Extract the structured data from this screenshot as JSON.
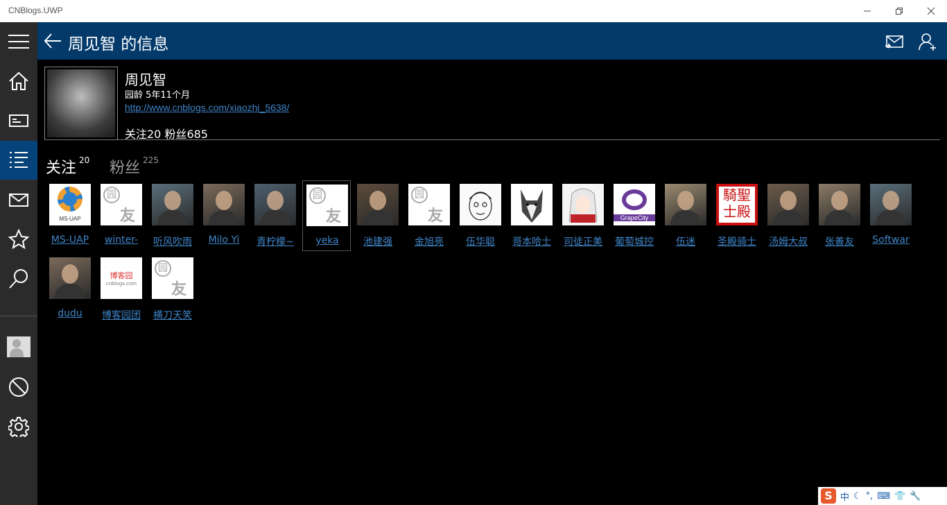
{
  "window": {
    "title": "CNBlogs.UWP"
  },
  "header": {
    "title": "周见智 的信息"
  },
  "profile": {
    "name": "周见智",
    "age": "园龄 5年11个月",
    "url": "http://www.cnblogs.com/xiaozhi_5638/",
    "stats": "关注20  粉丝685"
  },
  "tabs": [
    {
      "label": "关注",
      "count": "20"
    },
    {
      "label": "粉丝",
      "count": "225"
    }
  ],
  "follows": [
    {
      "name": "MS-UAP",
      "avatar": "gear-logo"
    },
    {
      "name": "winter-",
      "avatar": "default"
    },
    {
      "name": "听风吹雨",
      "avatar": "photo"
    },
    {
      "name": "Milo Yi",
      "avatar": "photo"
    },
    {
      "name": "青柠檬~",
      "avatar": "photo"
    },
    {
      "name": "yeka",
      "avatar": "default"
    },
    {
      "name": "池建强",
      "avatar": "photo"
    },
    {
      "name": "金旭亮",
      "avatar": "default"
    },
    {
      "name": "伍华聪",
      "avatar": "sketch"
    },
    {
      "name": "哥本哈士",
      "avatar": "husky"
    },
    {
      "name": "司徒正美",
      "avatar": "anime"
    },
    {
      "name": "葡萄城控",
      "avatar": "grapecity"
    },
    {
      "name": "伍迷",
      "avatar": "photo"
    },
    {
      "name": "圣殿骑士",
      "avatar": "seal"
    },
    {
      "name": "汤姆大叔",
      "avatar": "photo"
    },
    {
      "name": "张善友",
      "avatar": "photo"
    },
    {
      "name": "Softwar",
      "avatar": "photo"
    },
    {
      "name": "dudu",
      "avatar": "photo"
    },
    {
      "name": "博客园团",
      "avatar": "cnblogs"
    },
    {
      "name": "横刀天笑",
      "avatar": "default"
    }
  ],
  "avatar_text": {
    "default_1": "园",
    "default_2": "友",
    "ms_uap": "MS-UAP",
    "grapecity": "GrapeCity",
    "seal": "騎聖士殿",
    "cnblogs": "博客园",
    "cnblogs_sub": "cnblogs.com"
  },
  "tray": {
    "ime": "中",
    "logo": "S"
  },
  "colors": {
    "header": "#043a6a",
    "active_nav": "#06437a",
    "link": "#3f85c8",
    "sidebar": "#2b2b2b"
  }
}
